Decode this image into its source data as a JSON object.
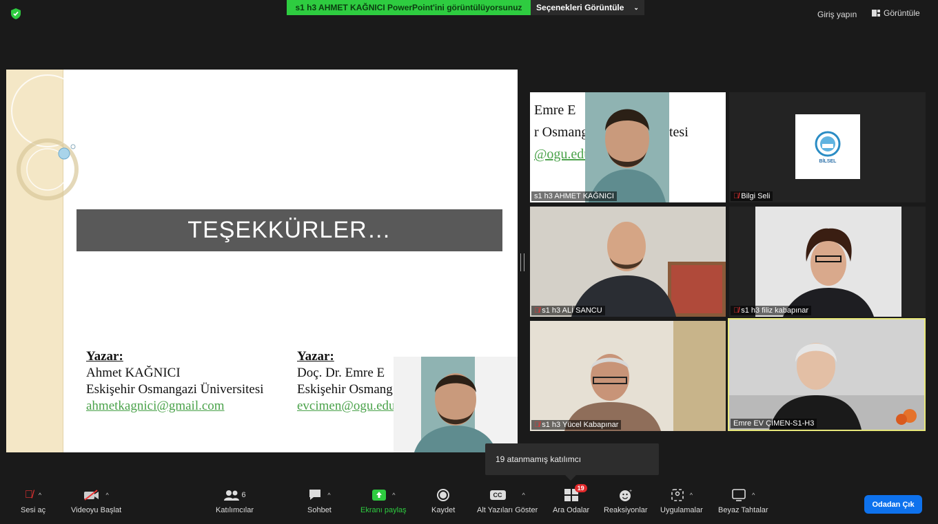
{
  "top_bar": {
    "share_banner": "s1 h3 AHMET KAĞNICI PowerPoint'ini görüntülüyorsunuz",
    "view_options": "Seçenekleri Görüntüle",
    "sign_in": "Giriş yapın",
    "view": "Görüntüle"
  },
  "slide": {
    "title": "TEŞEKKÜRLER…",
    "author1": {
      "heading": "Yazar:",
      "name": "Ahmet KAĞNICI",
      "affiliation": "Eskişehir Osmangazi Üniversitesi",
      "email": "ahmetkagnici@gmail.com"
    },
    "author2": {
      "heading": "Yazar:",
      "name": "Doç. Dr. Emre E",
      "affiliation_a": "Eskişehir Osmang",
      "affiliation_b": "tesi",
      "email": "evcimen@ogu.edu"
    }
  },
  "tiles": [
    {
      "name": "s1 h3 AHMET KAĞNICI",
      "muted": false,
      "bg_lines": [
        "Emre E",
        "r Osmang",
        "@ogu.edu",
        "tesi"
      ]
    },
    {
      "name": "Bilgi Seli",
      "muted": true,
      "logo_text": "BİLSEL"
    },
    {
      "name": "s1 h3 ALİ SANCU",
      "muted": true
    },
    {
      "name": "s1 h3 filiz kabapınar",
      "muted": true
    },
    {
      "name": "s1 h3 Yücel Kabapınar",
      "muted": true
    },
    {
      "name": "Emre EV ÇİMEN-S1-H3",
      "muted": false
    }
  ],
  "tooltip": "19 atanmamış katılımcı",
  "toolbar": {
    "mute": "Sesi aç",
    "video": "Videoyu Başlat",
    "participants": "Katılımcılar",
    "participants_count": "6",
    "chat": "Sohbet",
    "share": "Ekranı paylaş",
    "record": "Kaydet",
    "captions": "Alt Yazıları Göster",
    "captions_icon_text": "CC",
    "breakout": "Ara Odalar",
    "breakout_badge": "19",
    "reactions": "Reaksiyonlar",
    "apps": "Uygulamalar",
    "whiteboards": "Beyaz Tahtalar",
    "leave": "Odadan Çık"
  },
  "colors": {
    "share_green": "#2ecc40",
    "leave_blue": "#0e72ed",
    "active_speaker": "#e8e87a",
    "muted_red": "#e33333"
  }
}
